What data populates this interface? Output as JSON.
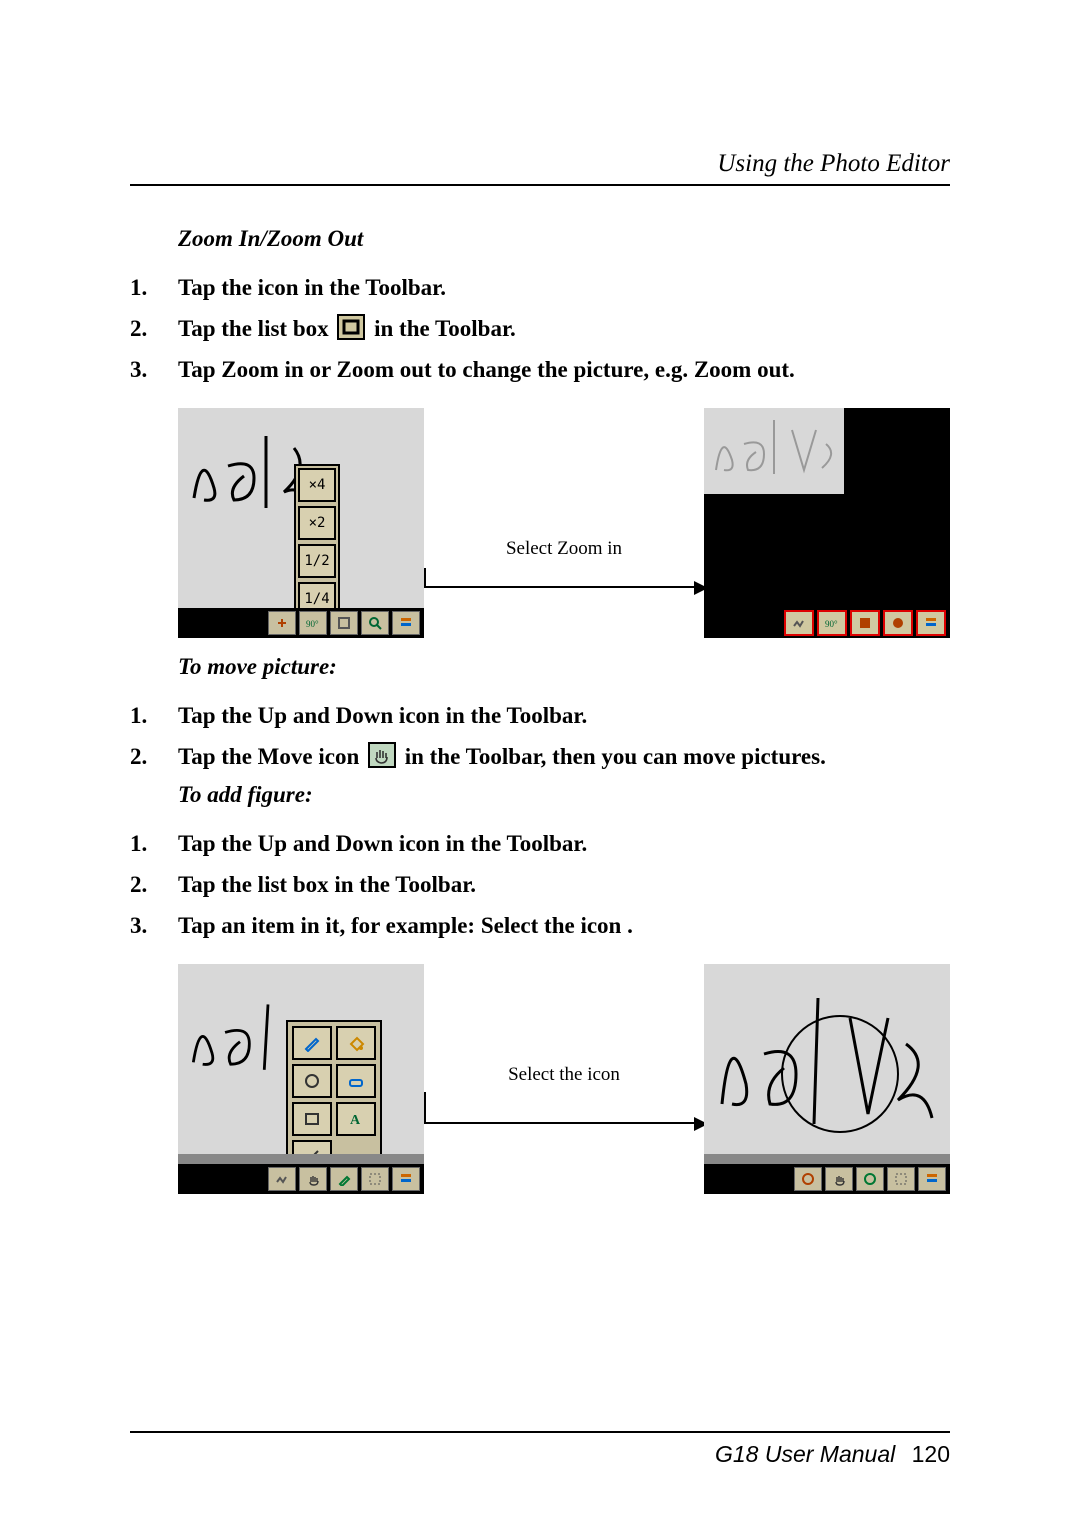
{
  "header": {
    "title": "Using the Photo Editor"
  },
  "section1": {
    "title": "Zoom In/Zoom Out",
    "steps": [
      {
        "n": "1.",
        "pre": "Tap the icon ",
        "post": " in the Toolbar."
      },
      {
        "n": "2.",
        "pre": "Tap the list box ",
        "post": " in the Toolbar."
      },
      {
        "n": "3.",
        "pre": "Tap Zoom in or Zoom out to change the picture, e.g. Zoom out.",
        "post": ""
      }
    ],
    "figure": {
      "arrow_label": "Select Zoom in",
      "zoom_options": [
        "×4",
        "×2",
        "1/2",
        "1/4"
      ]
    }
  },
  "section2": {
    "title": "To move picture:",
    "steps": [
      {
        "n": "1.",
        "pre": "Tap the Up and Down icon ",
        "post": " in the Toolbar."
      },
      {
        "n": "2.",
        "pre": "Tap the Move icon ",
        "post": " in the Toolbar, then you can move pictures."
      }
    ]
  },
  "section3": {
    "title": "To add figure:",
    "steps": [
      {
        "n": "1.",
        "pre": "Tap the Up and Down icon ",
        "post": " in the Toolbar."
      },
      {
        "n": "2.",
        "pre": "Tap the list box ",
        "post": " in the Toolbar."
      },
      {
        "n": "3.",
        "pre": "Tap an item in it, for example: Select the icon ",
        "post": "."
      }
    ],
    "figure": {
      "arrow_label": "Select the icon"
    }
  },
  "footer": {
    "manual": "G18 User Manual",
    "page": "120"
  }
}
